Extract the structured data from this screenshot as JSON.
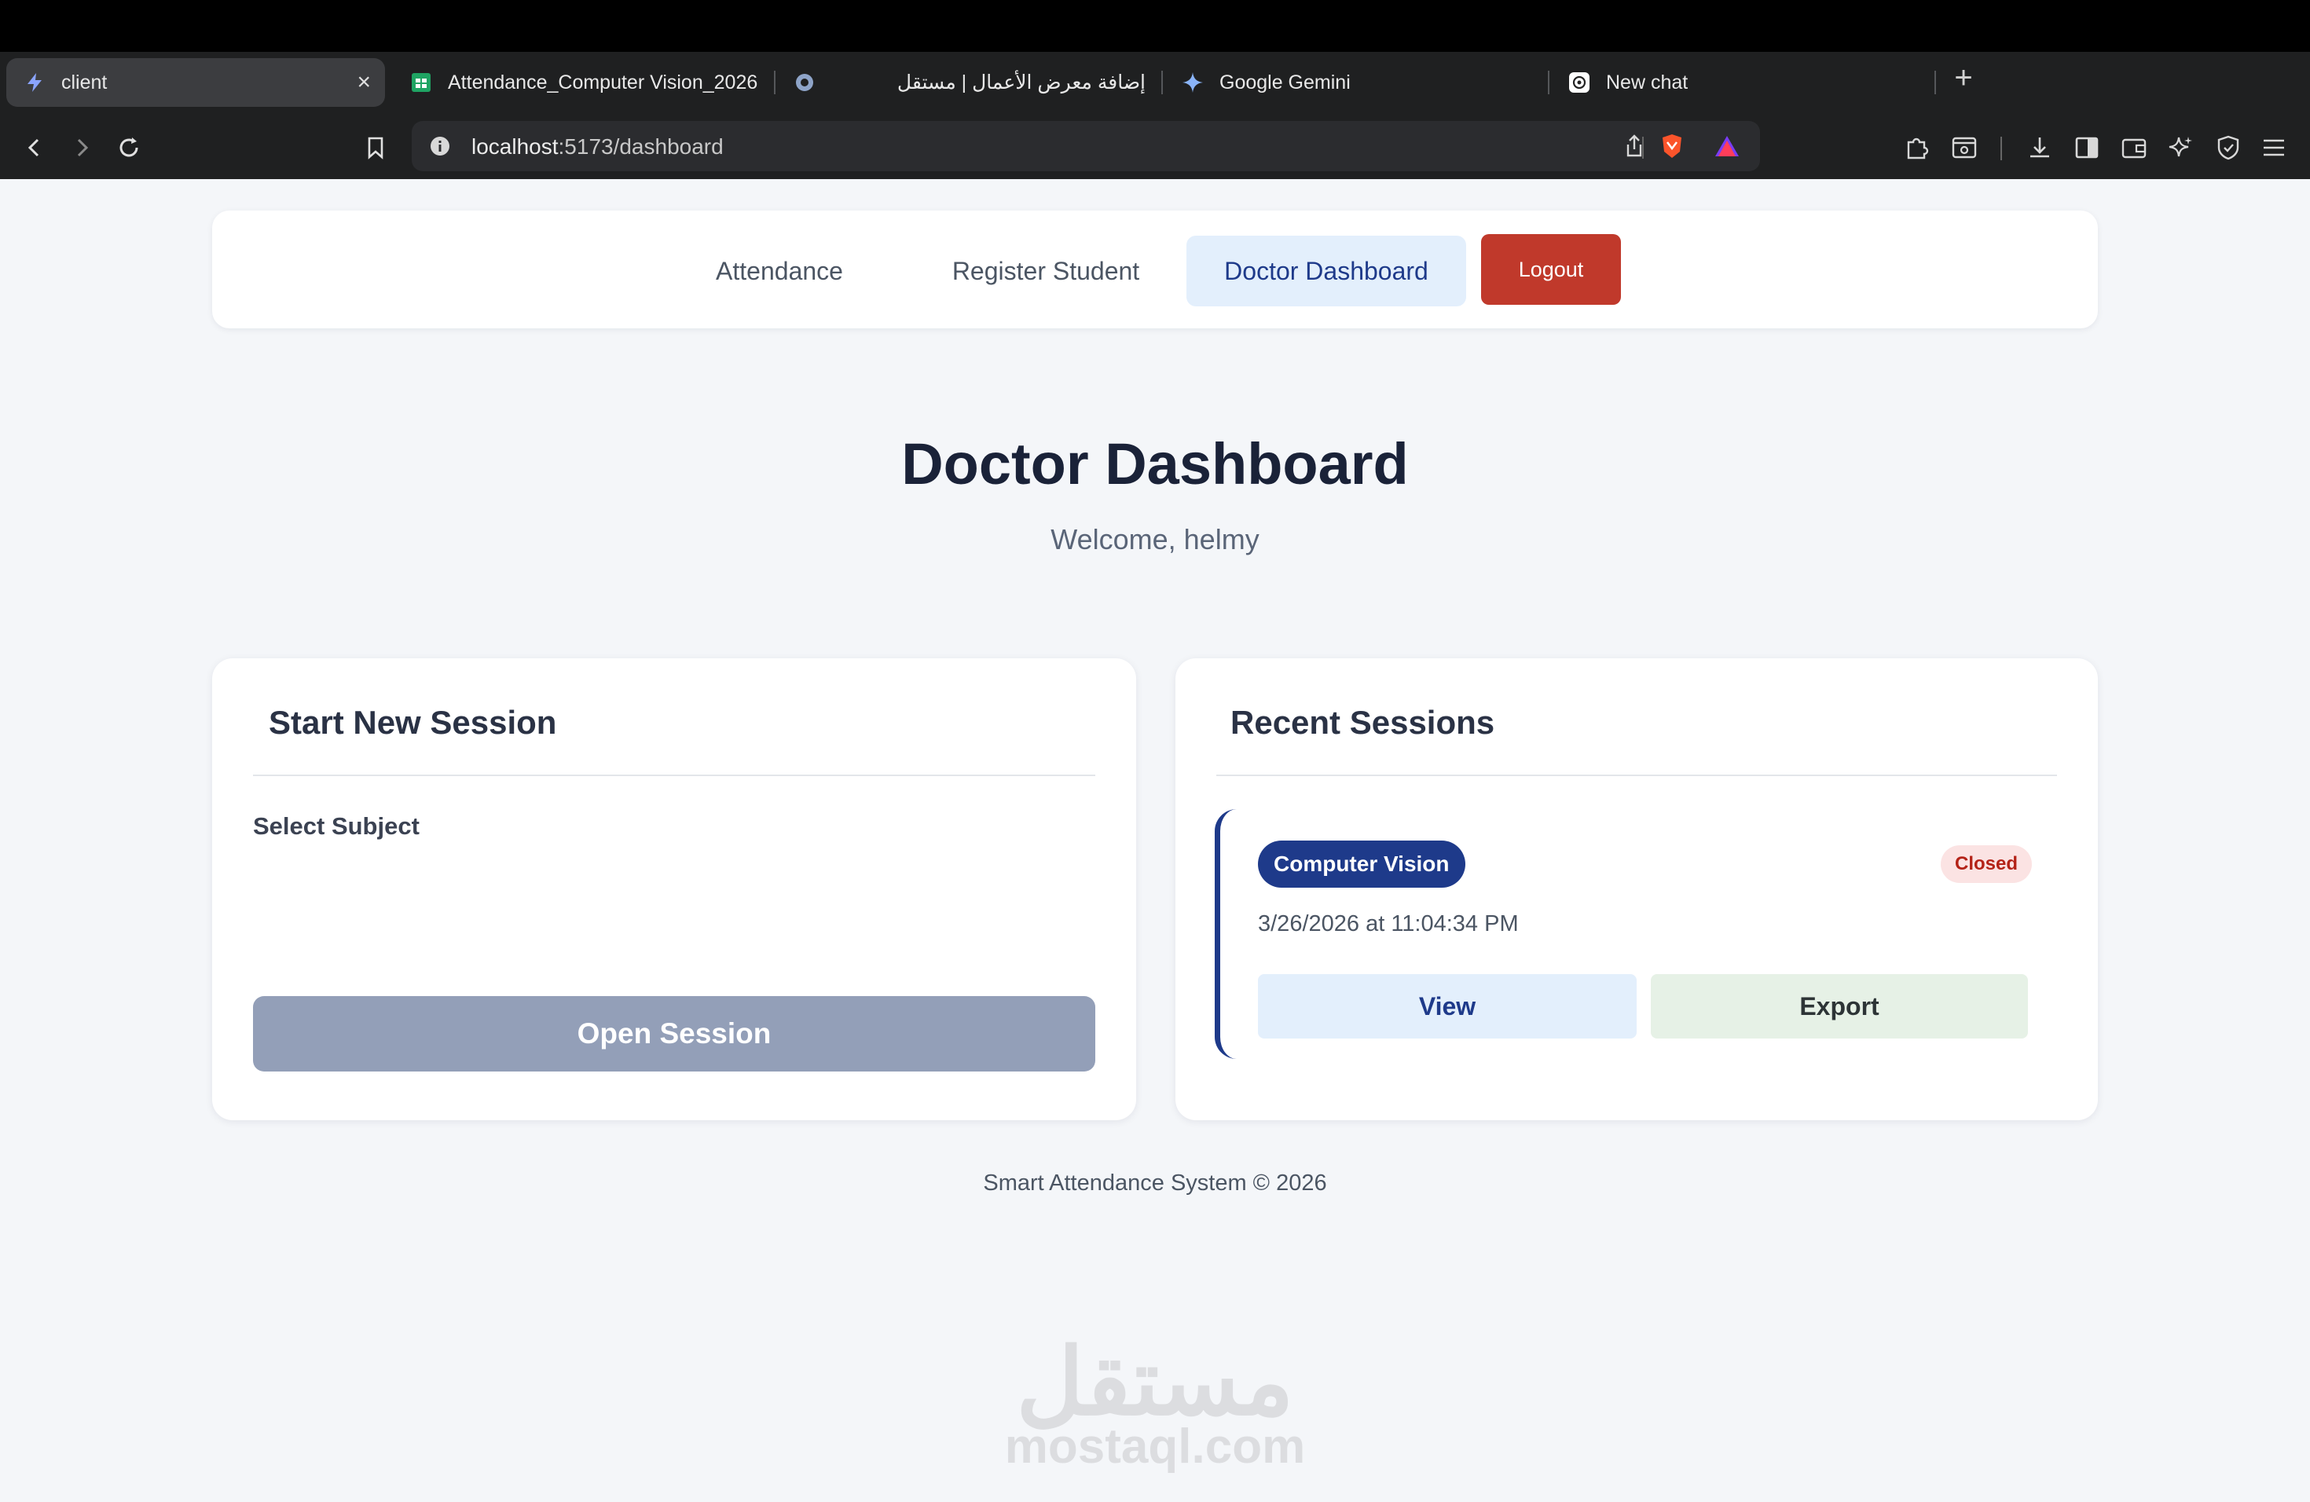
{
  "browser": {
    "tabs": [
      {
        "title": "client",
        "icon": "bolt-favicon",
        "active": true
      },
      {
        "title": "Attendance_Computer Vision_2026",
        "icon": "sheets-favicon",
        "active": false
      },
      {
        "title": "إضافة معرض الأعمال | مستقل",
        "icon": "ring-favicon",
        "active": false
      },
      {
        "title": "Google Gemini",
        "icon": "gemini-favicon",
        "active": false
      },
      {
        "title": "New chat",
        "icon": "chatgpt-favicon",
        "active": false
      }
    ],
    "url_host": "localhost",
    "url_path": ":5173/dashboard"
  },
  "nav": {
    "items": [
      {
        "label": "Attendance"
      },
      {
        "label": "Register Student"
      },
      {
        "label": "Doctor Dashboard",
        "active": true
      }
    ],
    "logout_label": "Logout"
  },
  "header": {
    "title": "Doctor Dashboard",
    "welcome": "Welcome, helmy"
  },
  "start_session": {
    "title": "Start New Session",
    "select_label": "Select Subject",
    "button_label": "Open Session"
  },
  "recent_sessions": {
    "title": "Recent Sessions",
    "items": [
      {
        "subject": "Computer Vision",
        "status": "Closed",
        "datetime": "3/26/2026 at 11:04:34 PM",
        "view_label": "View",
        "export_label": "Export"
      }
    ]
  },
  "footer": {
    "text": "Smart Attendance System © 2026"
  },
  "watermark": {
    "arabic": "مستقل",
    "latin": "mostaql.com"
  },
  "colors": {
    "primary": "#1e3a8a",
    "danger": "#c0392b",
    "disabled_button": "#939fb8",
    "page_bg": "#f4f6f9"
  }
}
